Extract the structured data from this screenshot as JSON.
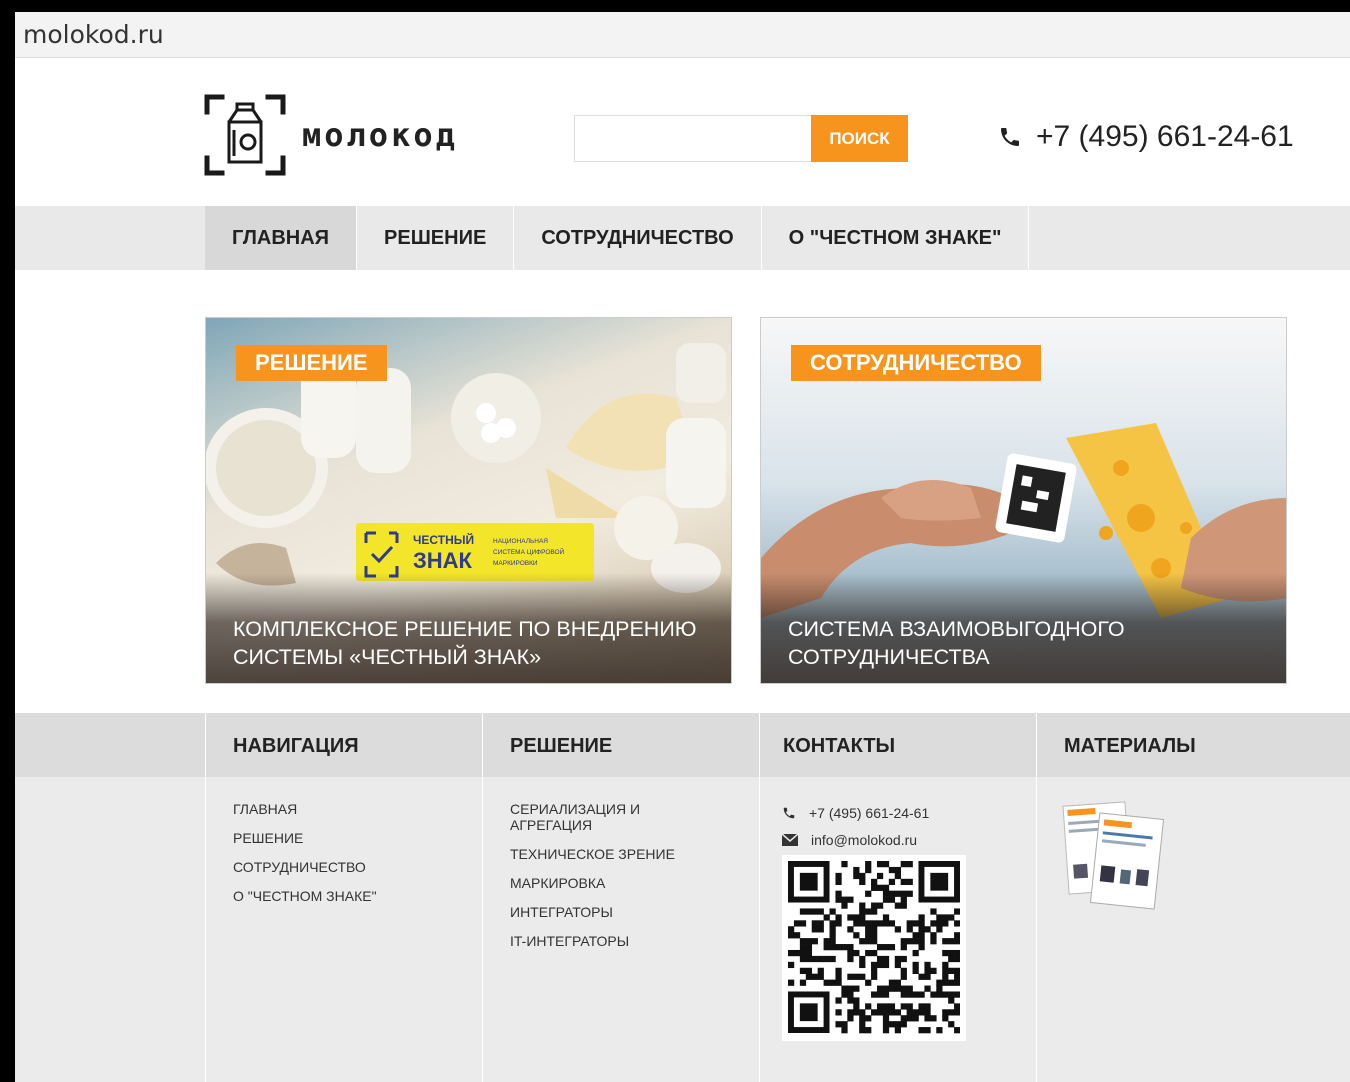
{
  "browser": {
    "url": "molokod.ru"
  },
  "header": {
    "logo_text": "молокод",
    "search_button": "ПОИСК",
    "search_placeholder": "",
    "phone": "+7 (495) 661-24-61"
  },
  "nav": {
    "items": [
      {
        "label": "ГЛАВНАЯ",
        "active": true
      },
      {
        "label": "РЕШЕНИЕ"
      },
      {
        "label": "СОТРУДНИЧЕСТВО"
      },
      {
        "label": "О \"ЧЕСТНОМ ЗНАКЕ\""
      }
    ]
  },
  "cards": [
    {
      "tag": "РЕШЕНИЕ",
      "caption": "КОМПЛЕКСНОЕ РЕШЕНИЕ ПО ВНЕДРЕНИЮ СИСТЕМЫ «ЧЕСТНЫЙ ЗНАК»",
      "badge_title": "ЧЕСТНЫЙ ЗНАК",
      "badge_sub": "НАЦИОНАЛЬНАЯ СИСТЕМА ЦИФРОВОЙ МАРКИРОВКИ"
    },
    {
      "tag": "СОТРУДНИЧЕСТВО",
      "caption": "СИСТЕМА ВЗАИМОВЫГОДНОГО СОТРУДНИЧЕСТВА"
    }
  ],
  "footer": {
    "navigation": {
      "title": "НАВИГАЦИЯ",
      "links": [
        "ГЛАВНАЯ",
        "РЕШЕНИЕ",
        "СОТРУДНИЧЕСТВО",
        "О \"ЧЕСТНОМ ЗНАКЕ\""
      ]
    },
    "solution": {
      "title": "РЕШЕНИЕ",
      "links": [
        "СЕРИАЛИЗАЦИЯ И АГРЕГАЦИЯ",
        "ТЕХНИЧЕСКОЕ ЗРЕНИЕ",
        "МАРКИРОВКА",
        "ИНТЕГРАТОРЫ",
        "IT-ИНТЕГРАТОРЫ"
      ]
    },
    "contacts": {
      "title": "КОНТАКТЫ",
      "phone": "+7 (495) 661-24-61",
      "email": "info@molokod.ru"
    },
    "materials": {
      "title": "МАТЕРИАЛЫ"
    }
  },
  "colors": {
    "accent": "#f7941d",
    "nav_bg": "#e9e9e9",
    "footer_bg": "#ebebeb"
  }
}
